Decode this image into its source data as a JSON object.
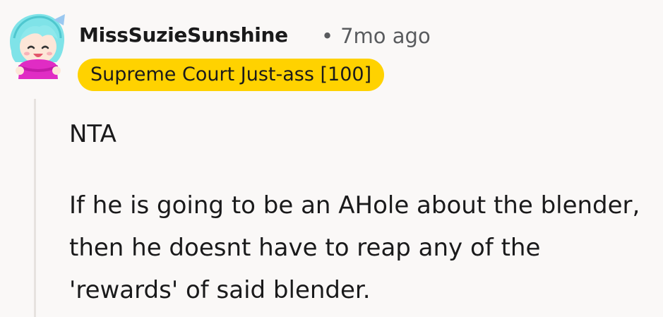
{
  "comment": {
    "author": "MissSuzieSunshine",
    "separator": "•",
    "timestamp": "7mo ago",
    "flair": "Supreme Court Just-ass [100]",
    "avatar_icon": "cartoon-girl-avatar-icon",
    "flair_color": "#ffd200",
    "paragraphs": [
      "NTA",
      "If he is going to be an AHole about the blender, then he doesnt have to reap any of the 'rewards' of said blender."
    ]
  }
}
